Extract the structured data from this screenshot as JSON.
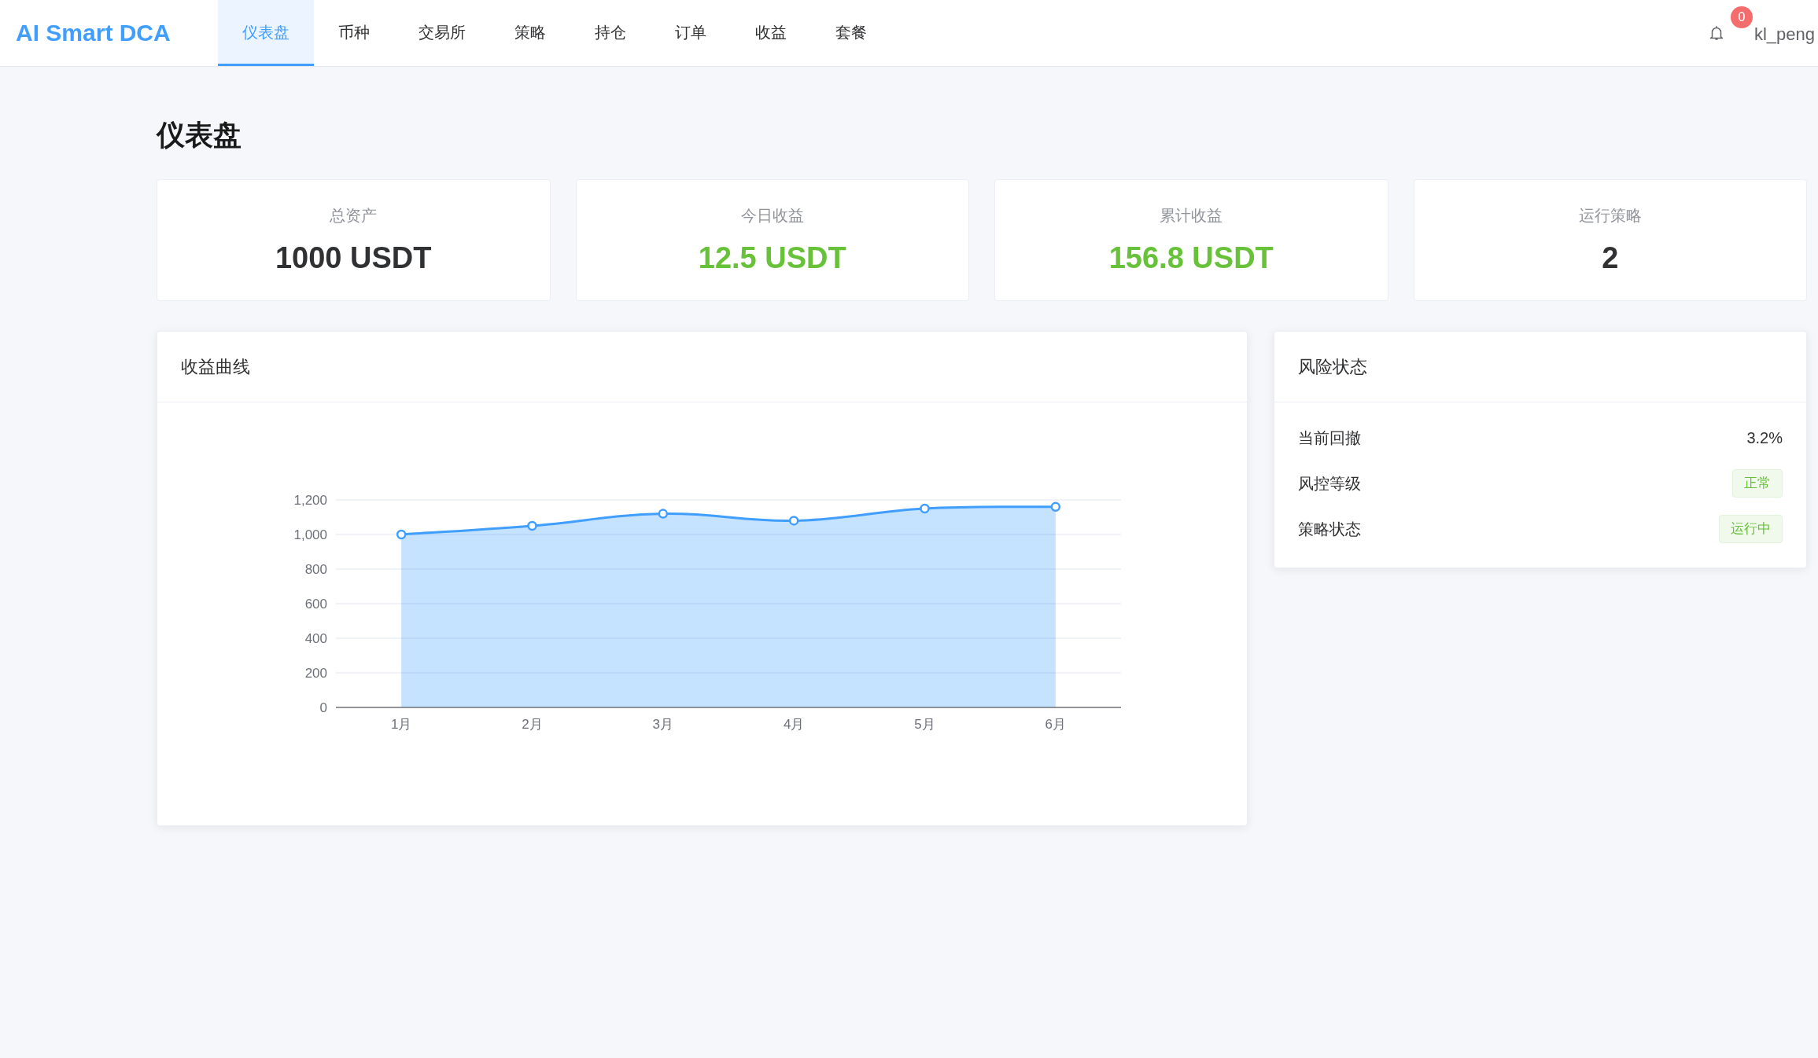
{
  "header": {
    "logo": "AI Smart DCA",
    "nav": [
      {
        "label": "仪表盘",
        "selected": true
      },
      {
        "label": "币种",
        "selected": false
      },
      {
        "label": "交易所",
        "selected": false
      },
      {
        "label": "策略",
        "selected": false
      },
      {
        "label": "持仓",
        "selected": false
      },
      {
        "label": "订单",
        "selected": false
      },
      {
        "label": "收益",
        "selected": false
      },
      {
        "label": "套餐",
        "selected": false
      }
    ],
    "notifications": {
      "count": "0"
    },
    "user": {
      "name": "kl_peng"
    }
  },
  "page": {
    "title": "仪表盘"
  },
  "stats": [
    {
      "label": "总资产",
      "value": "1000 USDT",
      "color": "#303133"
    },
    {
      "label": "今日收益",
      "value": "12.5 USDT",
      "color": "#67c23a"
    },
    {
      "label": "累计收益",
      "value": "156.8 USDT",
      "color": "#67c23a"
    },
    {
      "label": "运行策略",
      "value": "2",
      "color": "#303133"
    }
  ],
  "revenue_chart": {
    "title": "收益曲线",
    "chart_data": {
      "type": "area",
      "grid": true,
      "categories": [
        "1月",
        "2月",
        "3月",
        "4月",
        "5月",
        "6月"
      ],
      "series": [
        {
          "color": "#409eff",
          "values": [
            1000,
            1050,
            1120,
            1080,
            1150,
            1160
          ]
        }
      ],
      "ylim": [
        0,
        1200
      ],
      "yticks": [
        0,
        200,
        400,
        600,
        800,
        {
          "value": 1000,
          "label": "1,000"
        },
        {
          "value": 1200,
          "label": "1,200"
        }
      ]
    }
  },
  "risk_status": {
    "title": "风险状态",
    "rows": [
      {
        "label": "当前回撤",
        "kind": "text",
        "value": "3.2%"
      },
      {
        "label": "风控等级",
        "kind": "tag",
        "value": "正常",
        "color": "#67c23a"
      },
      {
        "label": "策略状态",
        "kind": "tag",
        "value": "运行中",
        "color": "#67c23a"
      }
    ]
  }
}
